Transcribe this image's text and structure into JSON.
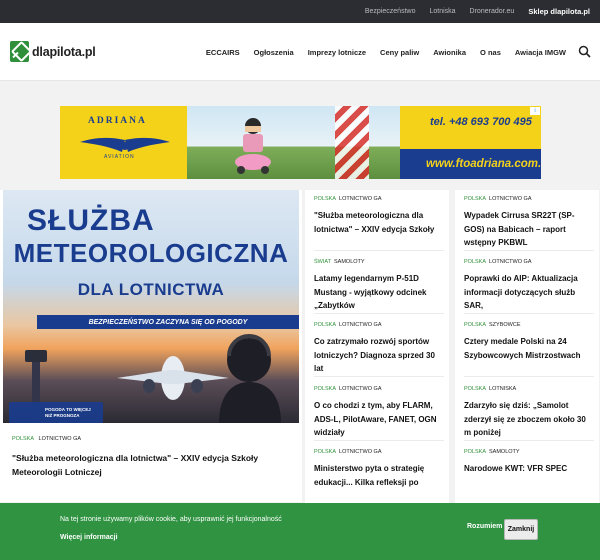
{
  "topbar": {
    "links": [
      "Bezpieczeństwo",
      "Lotniska",
      "Dronerador.eu"
    ],
    "shop": "Sklep dlapilota.pl"
  },
  "header": {
    "logo": "dlapilota.pl",
    "nav": [
      "ECCAIRS",
      "Ogłoszenia",
      "Imprezy lotnicze",
      "Ceny paliw",
      "Awionika",
      "O nas",
      "Awiacja IMGW"
    ]
  },
  "ad": {
    "brand": "ADRIANA",
    "sub": "AVIATION",
    "phone": "tel. +48 693 700 495",
    "url": "www.ftoadriana.com.pl",
    "info": "i"
  },
  "featured": {
    "image_line1": "SŁUŻBA",
    "image_line2": "METEOROLOGICZNA",
    "image_line3": "DLA LOTNICTWA",
    "image_band": "BEZPIECZEŃSTWO ZACZYNA SIĘ OD POGODY",
    "image_badge": "POGODA TO WIĘCEJ NIŻ PROGNOZA",
    "cat1": "POLSKA",
    "cat2": "LOTNICTWO GA",
    "title": "\"Służba meteorologiczna dla lotnictwa\" – XXIV edycja Szkoły Meteorologii Lotniczej"
  },
  "articles_col1": [
    {
      "cat1": "POLSKA",
      "cat2": "LOTNICTWO GA",
      "title": "\"Służba meteorologiczna dla lotnictwa\" – XXIV edycja Szkoły"
    },
    {
      "cat1": "ŚWIAT",
      "cat2": "SAMOLOTY",
      "title": "Latamy legendarnym P-51D Mustang - wyjątkowy odcinek „Zabytków"
    },
    {
      "cat1": "POLSKA",
      "cat2": "LOTNICTWO GA",
      "title": "Co zatrzymało rozwój sportów lotniczych? Diagnoza sprzed 30 lat"
    },
    {
      "cat1": "POLSKA",
      "cat2": "LOTNICTWO GA",
      "title": "O co chodzi z tym, aby FLARM, ADS-L, PilotAware, FANET, OGN widziały"
    },
    {
      "cat1": "POLSKA",
      "cat2": "LOTNICTWO GA",
      "title": "Ministerstwo pyta o strategię edukacji... Kilka refleksji po"
    }
  ],
  "articles_col2": [
    {
      "cat1": "POLSKA",
      "cat2": "LOTNICTWO GA",
      "title": "Wypadek Cirrusa SR22T (SP-GOS) na Babicach – raport wstępny PKBWL"
    },
    {
      "cat1": "POLSKA",
      "cat2": "LOTNICTWO GA",
      "title": "Poprawki do AIP: Aktualizacja informacji dotyczących służb SAR,"
    },
    {
      "cat1": "POLSKA",
      "cat2": "SZYBOWCE",
      "title": "Cztery medale Polski na 24 Szybowcowych Mistrzostwach"
    },
    {
      "cat1": "POLSKA",
      "cat2": "LOTNISKA",
      "title": "Zdarzyło się dziś: „Samolot zderzył się ze zboczem około 30 m poniżej"
    },
    {
      "cat1": "POLSKA",
      "cat2": "SAMOLOTY",
      "title": "Narodowe KWT: VFR SPEC"
    }
  ],
  "cookie": {
    "text": "Na tej stronie używamy plików cookie, aby usprawnić jej funkcjonalność",
    "more": "Więcej informacji",
    "accept": "Rozumiem",
    "close": "Zamknij"
  },
  "colors": {
    "brand_green": "#2f8f3a",
    "topbar": "#2b2d33",
    "ad_yellow": "#f4d21a",
    "ad_blue": "#1b3d8f"
  }
}
